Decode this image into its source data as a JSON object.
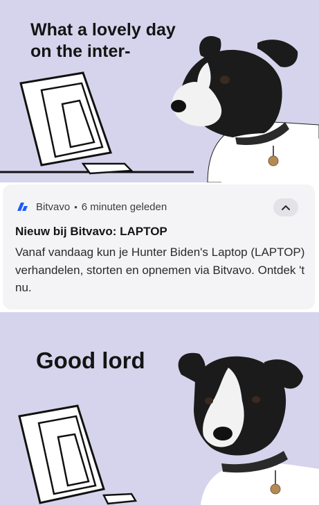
{
  "top_meme": {
    "caption": "What a lovely day on the inter-"
  },
  "notification": {
    "app_icon": "bitvavo-logo-icon",
    "app_name": "Bitvavo",
    "separator": "•",
    "time": "6 minuten geleden",
    "expand_icon": "chevron-up-icon",
    "title": "Nieuw bij Bitvavo: LAPTOP",
    "body": "Vanaf vandaag kun je Hunter Biden's Laptop (LAPTOP) verhandelen, storten en opnemen via Bitvavo. Ontdek 't nu."
  },
  "bottom_meme": {
    "caption": "Good lord"
  },
  "colors": {
    "meme_background": "#d6d4ec",
    "notification_background": "#f4f4f6",
    "brand_blue": "#1a5cff"
  }
}
